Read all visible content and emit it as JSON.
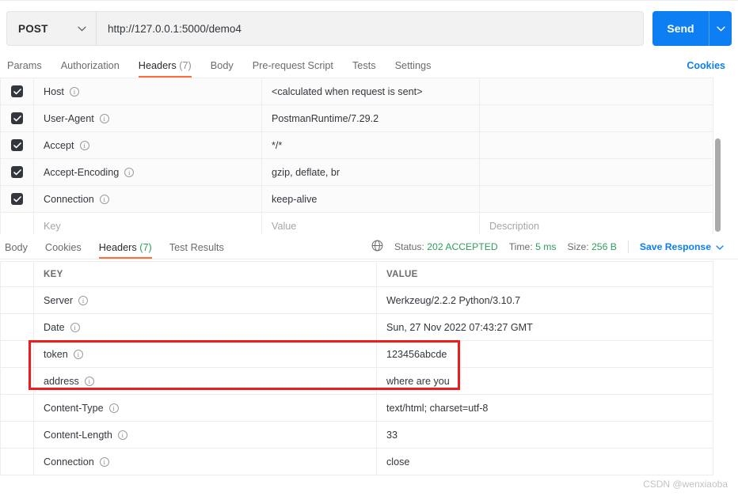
{
  "request": {
    "method": "POST",
    "url": "http://127.0.0.1:5000/demo4",
    "send_label": "Send",
    "tabs": [
      {
        "label": "Params",
        "count": "",
        "active": false
      },
      {
        "label": "Authorization",
        "count": "",
        "active": false
      },
      {
        "label": "Headers",
        "count": "(7)",
        "active": true
      },
      {
        "label": "Body",
        "count": "",
        "active": false
      },
      {
        "label": "Pre-request Script",
        "count": "",
        "active": false
      },
      {
        "label": "Tests",
        "count": "",
        "active": false
      },
      {
        "label": "Settings",
        "count": "",
        "active": false
      }
    ],
    "cookies_label": "Cookies",
    "headers_columns": [
      "Key",
      "Value",
      "Description"
    ],
    "headers": [
      {
        "checked": true,
        "key": "Host",
        "value": "<calculated when request is sent>",
        "description": ""
      },
      {
        "checked": true,
        "key": "User-Agent",
        "value": "PostmanRuntime/7.29.2",
        "description": ""
      },
      {
        "checked": true,
        "key": "Accept",
        "value": "*/*",
        "description": ""
      },
      {
        "checked": true,
        "key": "Accept-Encoding",
        "value": "gzip, deflate, br",
        "description": ""
      },
      {
        "checked": true,
        "key": "Connection",
        "value": "keep-alive",
        "description": ""
      }
    ],
    "placeholder_row": {
      "key": "Key",
      "value": "Value",
      "description": "Description"
    }
  },
  "response": {
    "tabs": [
      {
        "label": "Body",
        "count": "",
        "active": false
      },
      {
        "label": "Cookies",
        "count": "",
        "active": false
      },
      {
        "label": "Headers",
        "count": "(7)",
        "active": true
      },
      {
        "label": "Test Results",
        "count": "",
        "active": false
      }
    ],
    "status": {
      "globe_icon": "globe-icon",
      "status_label": "Status:",
      "status_value": "202 ACCEPTED",
      "time_label": "Time:",
      "time_value": "5 ms",
      "size_label": "Size:",
      "size_value": "256 B",
      "save_label": "Save Response"
    },
    "columns": {
      "key": "KEY",
      "value": "VALUE"
    },
    "headers": [
      {
        "key": "Server",
        "value": "Werkzeug/2.2.2 Python/3.10.7",
        "highlighted": false
      },
      {
        "key": "Date",
        "value": "Sun, 27 Nov 2022 07:43:27 GMT",
        "highlighted": false
      },
      {
        "key": "token",
        "value": "123456abcde",
        "highlighted": true
      },
      {
        "key": "address",
        "value": "where are you",
        "highlighted": true
      },
      {
        "key": "Content-Type",
        "value": "text/html; charset=utf-8",
        "highlighted": false
      },
      {
        "key": "Content-Length",
        "value": "33",
        "highlighted": false
      },
      {
        "key": "Connection",
        "value": "close",
        "highlighted": false
      }
    ]
  },
  "annotation": {
    "color": "#ee1c1c"
  },
  "watermark": "CSDN @wenxiaoba",
  "colors": {
    "accent_orange": "#ff6c37",
    "brand_blue": "#0d7ff2",
    "status_green": "#2f9e5e",
    "annotation_red": "#ee1c1c"
  }
}
